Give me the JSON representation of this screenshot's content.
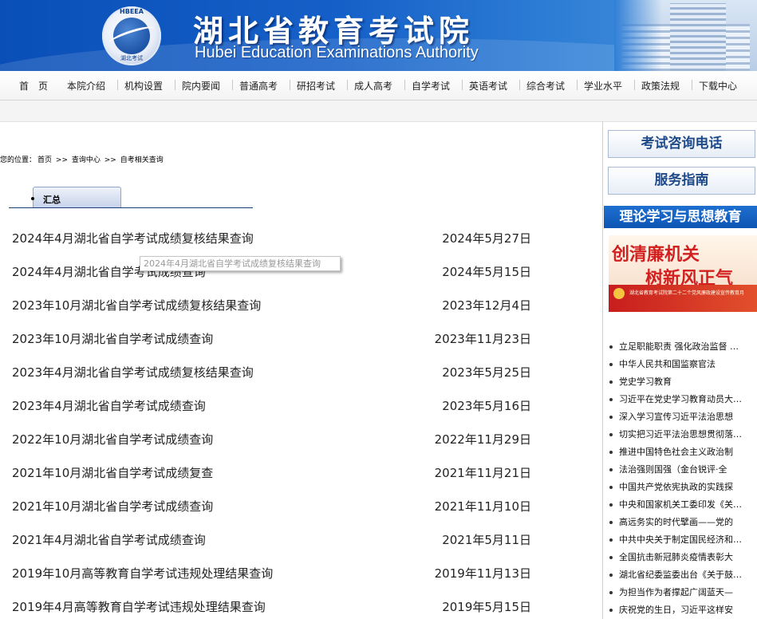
{
  "header": {
    "title_cn": "湖北省教育考试院",
    "title_en": "Hubei Education Examinations Authority",
    "logo_ring_top": "HBEEA",
    "logo_ring_bottom": "湖北考试"
  },
  "nav": [
    "首　页",
    "本院介绍",
    "机构设置",
    "院内要闻",
    "普通高考",
    "研招考试",
    "成人高考",
    "自学考试",
    "英语考试",
    "综合考试",
    "学业水平",
    "政策法规",
    "下载中心"
  ],
  "breadcrumb": {
    "prefix": "您的位置：",
    "items": [
      "首页",
      "查询中心",
      "自考相关查询"
    ],
    "sep": ">>"
  },
  "tab": {
    "label": "汇总"
  },
  "list": [
    {
      "title": "2024年4月湖北省自学考试成绩复核结果查询",
      "date": "2024年5月27日"
    },
    {
      "title": "2024年4月湖北省自学考试成绩查询",
      "date": "2024年5月15日"
    },
    {
      "title": "2023年10月湖北省自学考试成绩复核结果查询",
      "date": "2023年12月4日"
    },
    {
      "title": "2023年10月湖北省自学考试成绩查询",
      "date": "2023年11月23日"
    },
    {
      "title": "2023年4月湖北省自学考试成绩复核结果查询",
      "date": "2023年5月25日"
    },
    {
      "title": "2023年4月湖北省自学考试成绩查询",
      "date": "2023年5月16日"
    },
    {
      "title": "2022年10月湖北省自学考试成绩查询",
      "date": "2022年11月29日"
    },
    {
      "title": "2021年10月湖北省自学考试成绩复查",
      "date": "2021年11月21日"
    },
    {
      "title": "2021年10月湖北省自学考试成绩查询",
      "date": "2021年11月10日"
    },
    {
      "title": "2021年4月湖北省自学考试成绩查询",
      "date": "2021年5月11日"
    },
    {
      "title": "2019年10月高等教育自学考试违规处理结果查询",
      "date": "2019年11月13日"
    },
    {
      "title": "2019年4月高等教育自学考试违规处理结果查询",
      "date": "2019年5月15日"
    }
  ],
  "tooltip": "2024年4月湖北省自学考试成绩复核结果查询",
  "sidebar": {
    "btn_phone": "考试咨询电话",
    "btn_guide": "服务指南",
    "section_title": "理论学习与思想教育",
    "promo_line1": "创清廉机关",
    "promo_line2": "树新风正气",
    "promo_sub": "湖北省教育考试院第二十二个党风廉政建设宣传教育月",
    "news": [
      "立足职能职责 强化政治监督 …",
      "中华人民共和国监察官法",
      "党史学习教育",
      "习近平在党史学习教育动员大…",
      "深入学习宣传习近平法治思想",
      "切实把习近平法治思想贯彻落…",
      "推进中国特色社会主义政治制",
      "法治强则国强（金台锐评·全",
      "中国共产党依宪执政的实践探",
      "中央和国家机关工委印发《关…",
      "高远务实的时代擘画——党的",
      "中共中央关于制定国民经济和…",
      "全国抗击新冠肺炎疫情表彰大",
      "湖北省纪委监委出台《关于鼓…",
      "为担当作为者撑起广阔蓝天—",
      "庆祝党的生日，习近平这样安"
    ]
  }
}
